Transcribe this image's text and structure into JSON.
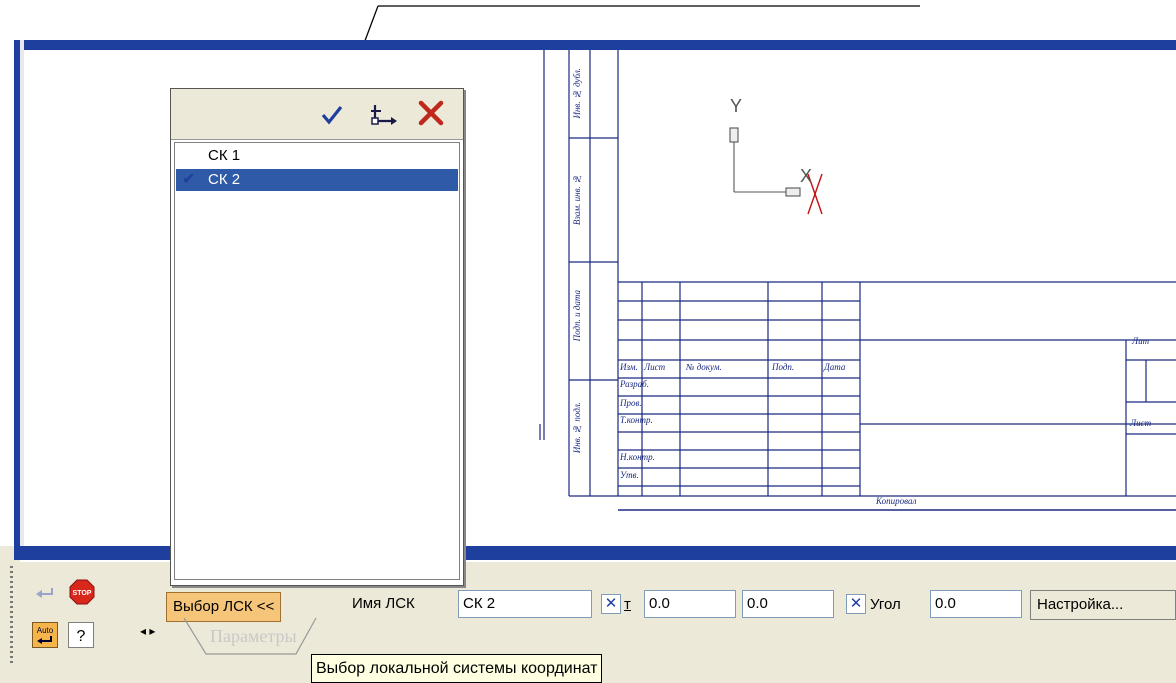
{
  "popup": {
    "header_icons": [
      "checkmark-icon",
      "axes-icon",
      "close-icon"
    ],
    "items": [
      {
        "label": "СК 1",
        "selected": false
      },
      {
        "label": "СК 2",
        "selected": true
      }
    ]
  },
  "panel": {
    "choose_lsk_button": "Выбор ЛСК  <<",
    "name_label": "Имя ЛСК",
    "name_value": "СК 2",
    "x_label": "т",
    "x_value": "0.0",
    "y_value": "0.0",
    "angle_label": "Угол",
    "angle_value": "0.0",
    "settings_button": "Настройка...",
    "tab_label": "Параметры",
    "auto_label": "Auto",
    "stop_label": "STOP"
  },
  "tooltip": "Выбор локальной системы координат",
  "drawing": {
    "axis_y": "Y",
    "axis_x": "X",
    "stamp": {
      "row_header": [
        "Изм.",
        "Лист",
        "№ докум.",
        "Подп.",
        "Дата"
      ],
      "rows": [
        "Разраб.",
        "Пров.",
        "Т.контр.",
        "",
        "Н.контр.",
        "Утв."
      ],
      "right_labels": [
        "Лит",
        "Лист"
      ],
      "bottom_label": "Копировал",
      "side_labels": [
        "Инв. № подл.",
        "Подп. и дата",
        "Взам. инв. №",
        "Инв. № дубл."
      ]
    }
  },
  "colors": {
    "frame_blue": "#1f3f9e",
    "selected_blue": "#2e5aa8",
    "panel_bg": "#ece9d8",
    "tooltip_bg": "#ffffe1"
  }
}
